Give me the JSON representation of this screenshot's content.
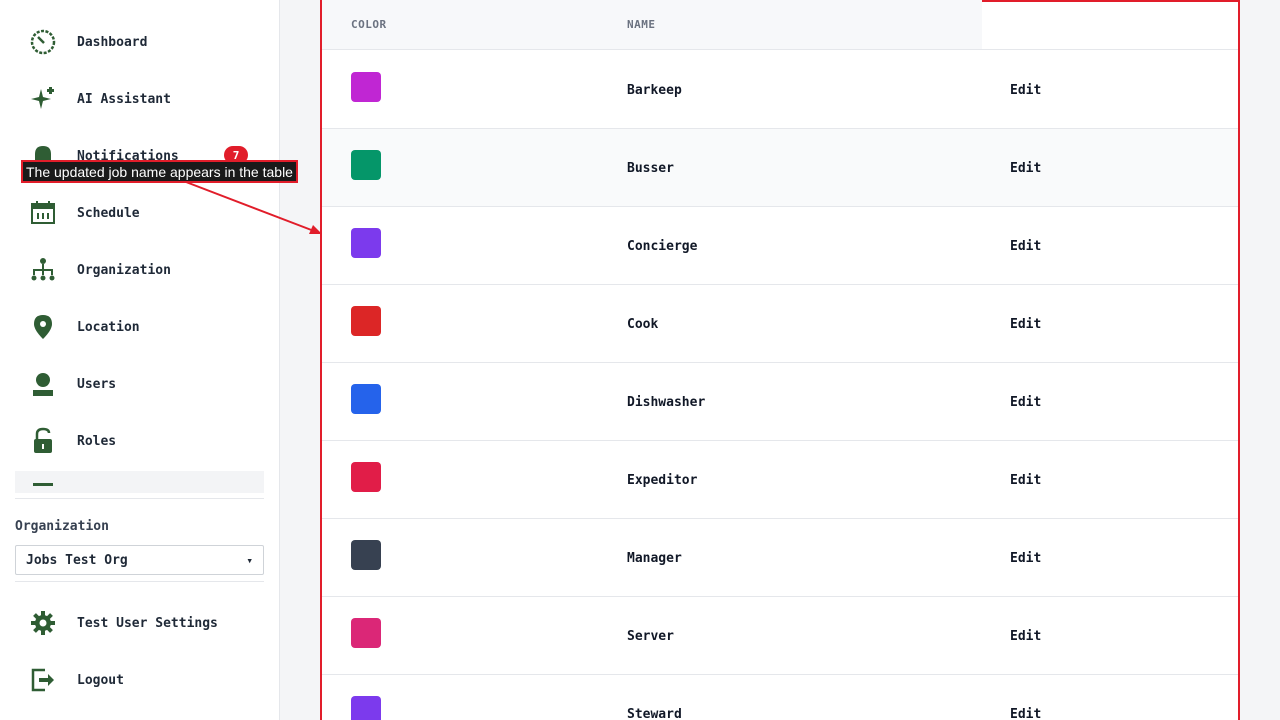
{
  "sidebar": {
    "items": [
      {
        "label": "Dashboard",
        "icon": "dashboard-icon"
      },
      {
        "label": "AI Assistant",
        "icon": "sparkle-icon"
      },
      {
        "label": "Notifications",
        "icon": "bell-icon",
        "badge": "7"
      },
      {
        "label": "Schedule",
        "icon": "calendar-icon"
      },
      {
        "label": "Organization",
        "icon": "org-chart-icon"
      },
      {
        "label": "Location",
        "icon": "location-pin-icon"
      },
      {
        "label": "Users",
        "icon": "user-icon"
      },
      {
        "label": "Roles",
        "icon": "unlock-icon"
      }
    ],
    "organization": {
      "label": "Organization",
      "selected": "Jobs Test Org"
    },
    "footer": [
      {
        "label": "Test User Settings",
        "icon": "gear-icon"
      },
      {
        "label": "Logout",
        "icon": "logout-icon"
      }
    ]
  },
  "table": {
    "headers": {
      "color": "COLOR",
      "name": "NAME"
    },
    "rows": [
      {
        "color": "#c026d3",
        "name": "Barkeep",
        "action": "Edit"
      },
      {
        "color": "#059669",
        "name": "Busser",
        "action": "Edit"
      },
      {
        "color": "#7c3aed",
        "name": "Concierge",
        "action": "Edit"
      },
      {
        "color": "#dc2626",
        "name": "Cook",
        "action": "Edit"
      },
      {
        "color": "#2563eb",
        "name": "Dishwasher",
        "action": "Edit"
      },
      {
        "color": "#e11d48",
        "name": "Expeditor",
        "action": "Edit"
      },
      {
        "color": "#374151",
        "name": "Manager",
        "action": "Edit"
      },
      {
        "color": "#db2777",
        "name": "Server",
        "action": "Edit"
      },
      {
        "color": "#7c3aed",
        "name": "Steward",
        "action": "Edit"
      }
    ]
  },
  "annotation": {
    "text": "The updated job name appears in the table"
  },
  "colors": {
    "icon_green": "#2f5d34",
    "highlight_red": "#e11d2a"
  }
}
